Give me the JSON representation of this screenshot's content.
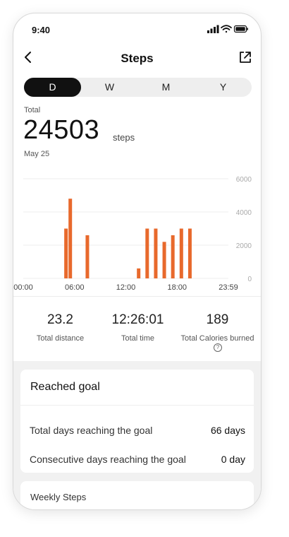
{
  "status": {
    "time": "9:40"
  },
  "header": {
    "title": "Steps"
  },
  "tabs": [
    {
      "label": "D",
      "active": true
    },
    {
      "label": "W",
      "active": false
    },
    {
      "label": "M",
      "active": false
    },
    {
      "label": "Y",
      "active": false
    }
  ],
  "summary": {
    "total_label": "Total",
    "total_value": "24503",
    "unit": "steps",
    "date": "May 25"
  },
  "colors": {
    "accent": "#E8692C",
    "active_tab": "#111111"
  },
  "chart_data": {
    "type": "bar",
    "x_ticks": [
      "00:00",
      "06:00",
      "12:00",
      "18:00",
      "23:59"
    ],
    "y_ticks": [
      "6000",
      "4000",
      "2000",
      "0"
    ],
    "ylim": [
      0,
      6000
    ],
    "x_range_hours": [
      0,
      24
    ],
    "grid": true,
    "bars": [
      {
        "hour": 5,
        "value": 3000
      },
      {
        "hour": 5.5,
        "value": 4800
      },
      {
        "hour": 7.5,
        "value": 2600
      },
      {
        "hour": 13.5,
        "value": 600
      },
      {
        "hour": 14.5,
        "value": 3000
      },
      {
        "hour": 15.5,
        "value": 3000
      },
      {
        "hour": 16.5,
        "value": 2200
      },
      {
        "hour": 17.5,
        "value": 2600
      },
      {
        "hour": 18.5,
        "value": 3000
      },
      {
        "hour": 19.5,
        "value": 3000
      }
    ]
  },
  "metrics": [
    {
      "value": "23.2",
      "label": "Total distance"
    },
    {
      "value": "12:26:01",
      "label": "Total time"
    },
    {
      "value": "189",
      "label": "Total Calories burned"
    }
  ],
  "goal": {
    "title": "Reached goal",
    "rows": [
      {
        "label": "Total days reaching the goal",
        "value": "66 days"
      },
      {
        "label": "Consecutive days reaching the goal",
        "value": "0 day"
      }
    ]
  },
  "weekly": {
    "title": "Weekly Steps"
  },
  "icons": {
    "back": "chevron-left-icon",
    "share": "share-external-icon",
    "signal": "signal-icon",
    "wifi": "wifi-icon",
    "battery": "battery-icon",
    "help": "question-circle-icon"
  }
}
